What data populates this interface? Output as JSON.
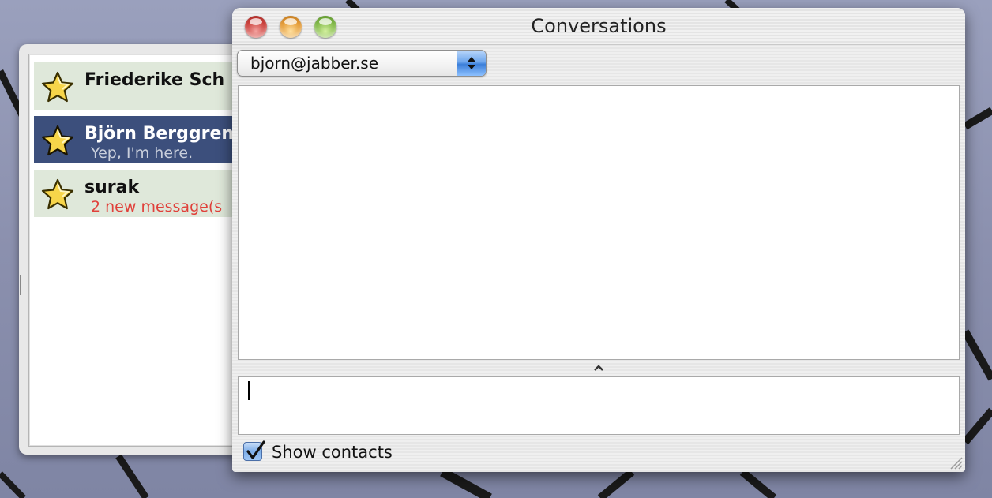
{
  "window": {
    "title": "Conversations"
  },
  "account_selector": {
    "selected": "bjorn@jabber.se"
  },
  "contacts": [
    {
      "name": "Friederike Sch",
      "status": "",
      "selected": false,
      "icon": "star-icon"
    },
    {
      "name": "Björn Berggren",
      "status": "Yep, I'm here.",
      "selected": true,
      "icon": "star-icon"
    },
    {
      "name": "surak",
      "status": "2 new message(s",
      "selected": false,
      "icon": "star-icon"
    }
  ],
  "show_contacts": {
    "label": "Show contacts",
    "checked": true
  },
  "colors": {
    "selected_row": "#3c4f7c",
    "contact_row": "#dfe8da",
    "alert_text": "#e0403a",
    "accent": "#3b7ed9"
  }
}
